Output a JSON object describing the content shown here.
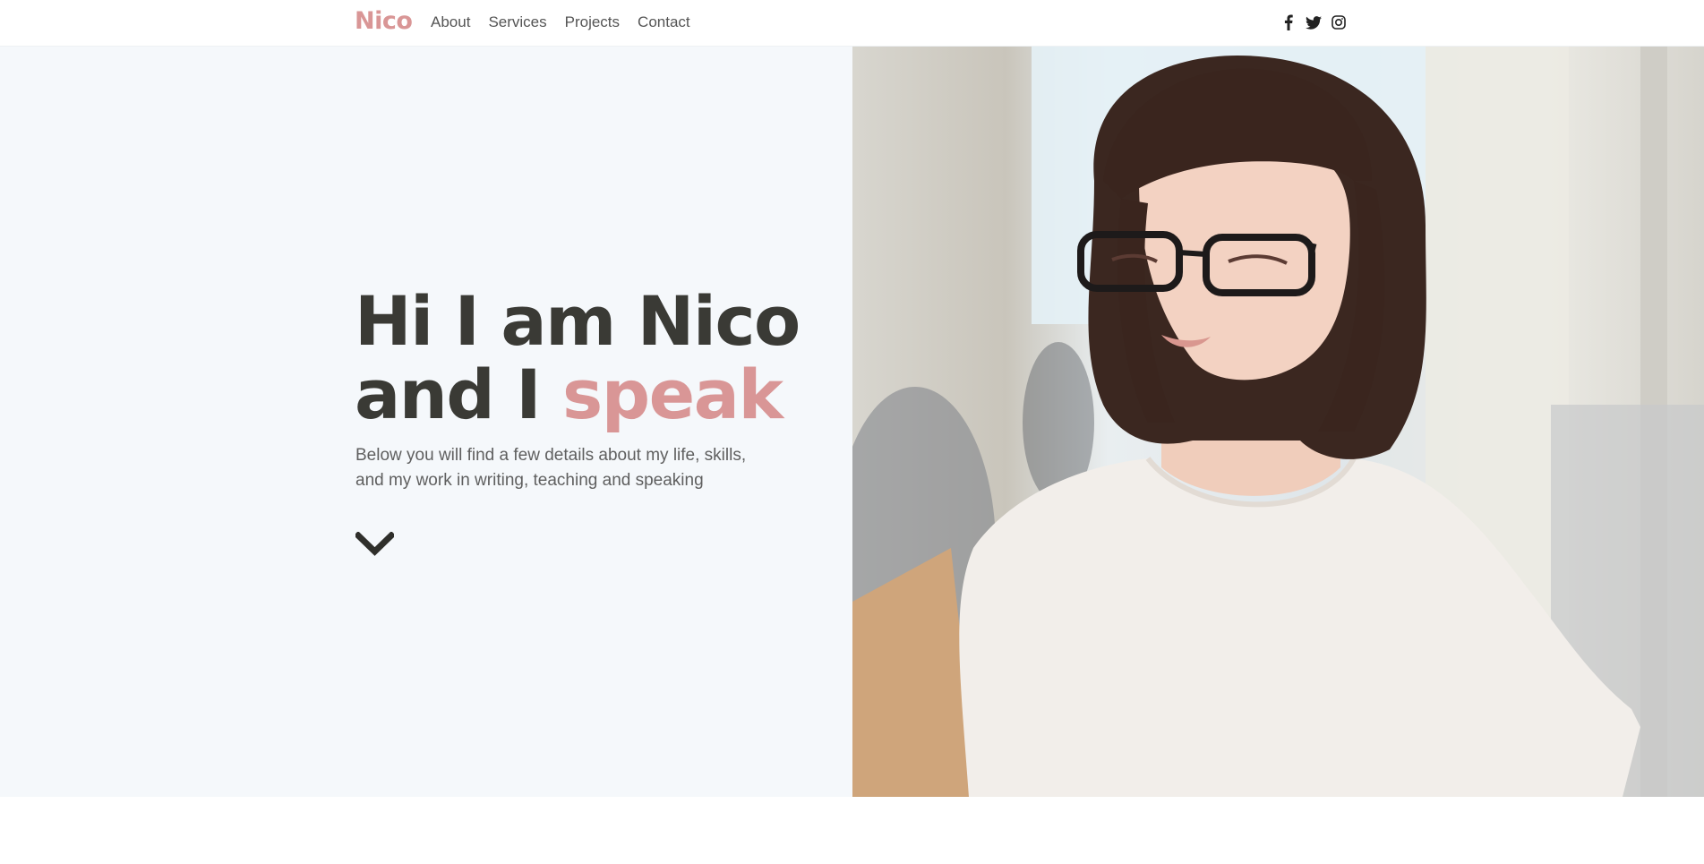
{
  "navbar": {
    "brand": "Nico",
    "links": [
      {
        "label": "About"
      },
      {
        "label": "Services"
      },
      {
        "label": "Projects"
      },
      {
        "label": "Contact"
      }
    ],
    "social": [
      "facebook-icon",
      "twitter-icon",
      "instagram-icon"
    ]
  },
  "hero": {
    "title_line1": "Hi I am Nico",
    "title_line2_prefix": "and I ",
    "title_accent": "speak",
    "subtitle_line1": "Below you will find a few details about my life, skills,",
    "subtitle_line2": "and my work in writing, teaching and speaking",
    "scroll_icon": "chevron-down-icon",
    "photo": "portrait-photo"
  },
  "colors": {
    "accent": "#d99696",
    "text_dark": "#3a3a35",
    "hero_bg": "#f5f8fb"
  }
}
